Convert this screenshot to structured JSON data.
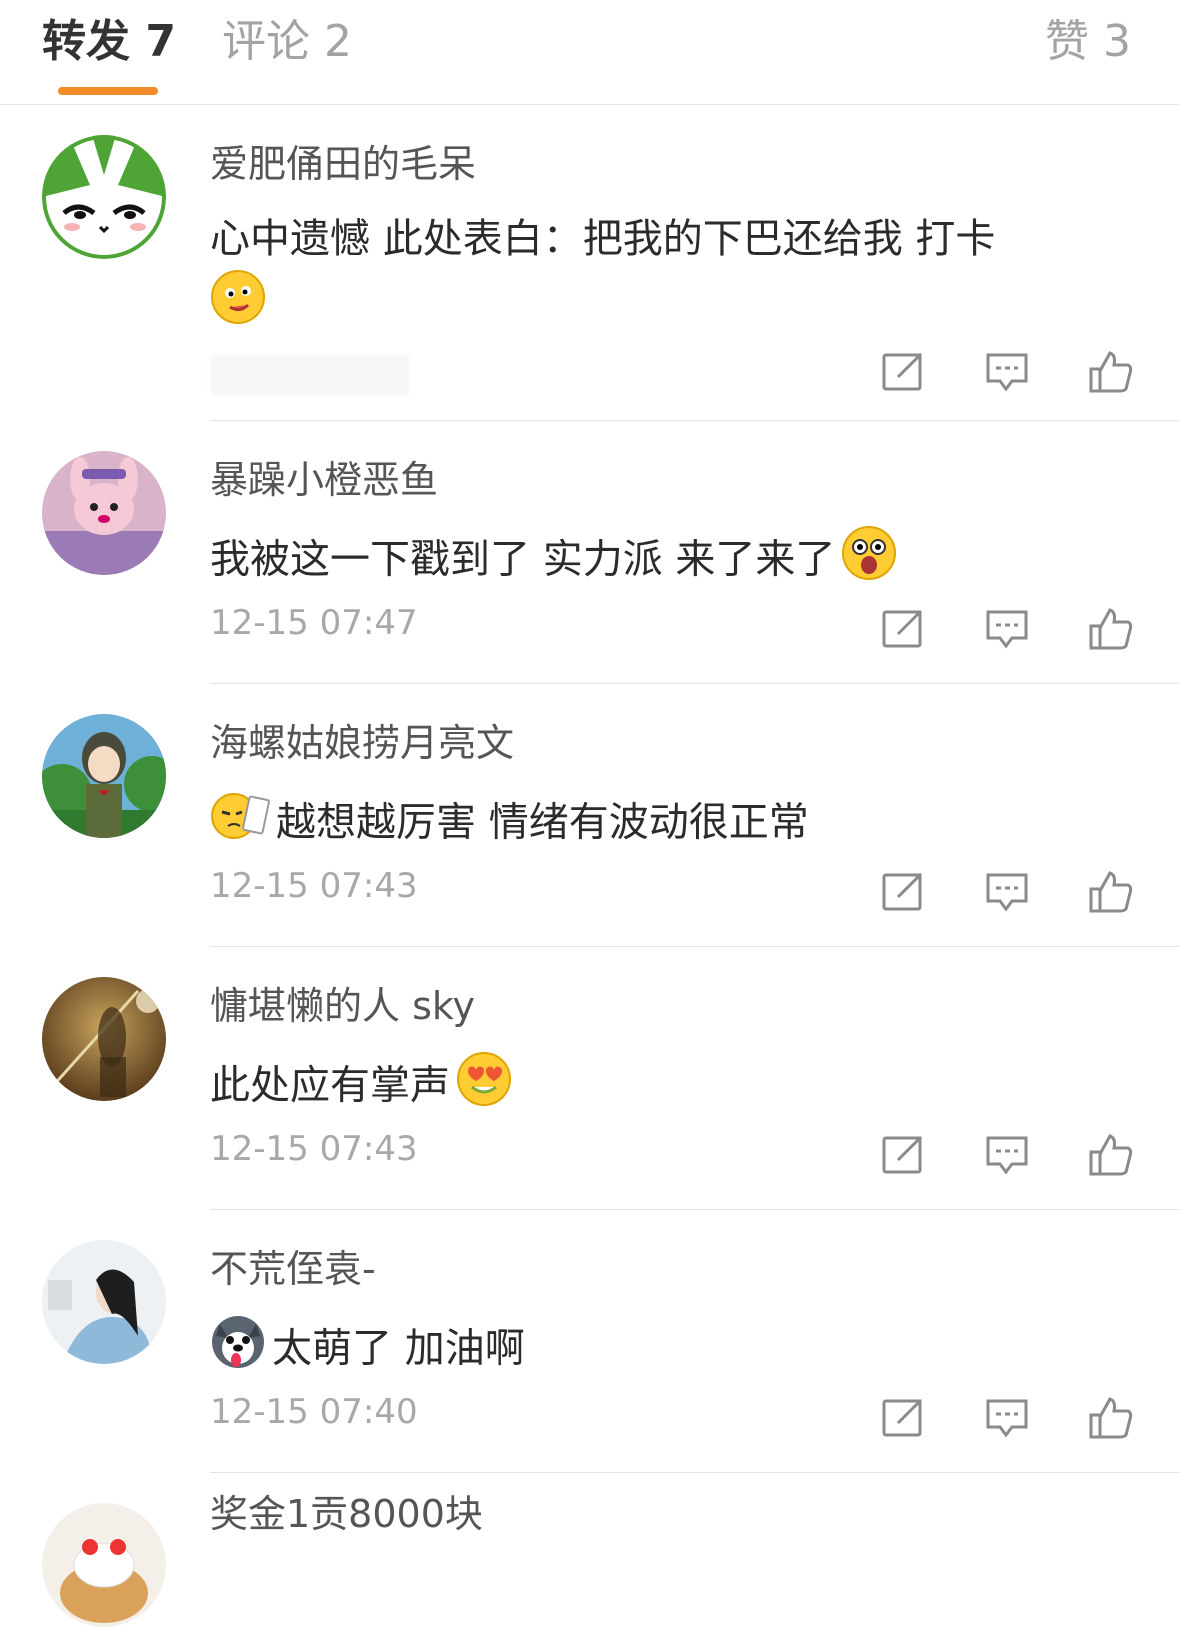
{
  "tabs": {
    "repost": "转发 7",
    "comments": "评论 2",
    "likes": "赞 3"
  },
  "colors": {
    "accent": "#f28c28",
    "text": "#2b2b2b",
    "muted": "#a8a8a8"
  },
  "reposts": [
    {
      "name": "爱肥俑田的毛呆",
      "text": "心中遗憾 此处表白：把我的下巴还给我 打卡",
      "emoji": "drooling-face-emoji",
      "time": ""
    },
    {
      "name": "暴躁小橙恶鱼",
      "text": "我被这一下戳到了 实力派 来了来了",
      "emoji": "excited-face-emoji",
      "time": "12-15 07:47"
    },
    {
      "name": "海螺姑娘捞月亮文",
      "text": "越想越厉害 情绪有波动很正常",
      "emoji": "face-with-ticket-emoji",
      "time": "12-15 07:43"
    },
    {
      "name": "慵堪懒的人 sky",
      "text": "此处应有掌声",
      "emoji": "heart-eyes-emoji",
      "time": "12-15 07:43"
    },
    {
      "name": "不荒侄袁-",
      "text": "太萌了 加油啊",
      "emoji": "husky-dog-emoji",
      "time": "12-15 07:40"
    },
    {
      "name": "奖金1贡8000块",
      "text": "",
      "emoji": "",
      "time": ""
    }
  ],
  "icons": {
    "repost": "repost-icon",
    "comment": "comment-icon",
    "like": "thumbs-up-icon"
  }
}
